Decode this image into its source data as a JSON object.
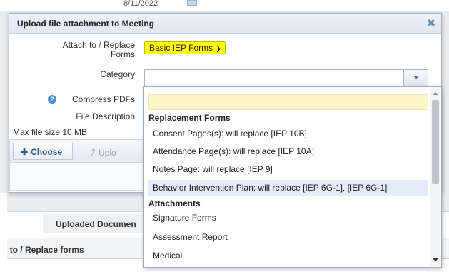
{
  "background": {
    "date": "8/11/2022",
    "uploaded_documents_header": "Uploaded Documen",
    "column_header": "h to / Replace forms"
  },
  "dialog": {
    "title": "Upload file attachment to Meeting",
    "close_icon": "close-icon",
    "close_glyph": "✖",
    "fields": {
      "attach_label": "Attach to / Replace Forms",
      "attach_value": "Basic IEP Forms",
      "category_label": "Category",
      "category_value": "",
      "compress_label": "Compress PDFs",
      "description_label": "File Description"
    },
    "max_file_size": "Max file size 10 MB",
    "toolbar": {
      "choose_label": "Choose",
      "upload_label": "Uplo"
    }
  },
  "dropdown": {
    "groups": [
      {
        "label": "Replacement Forms",
        "items": [
          "Consent Pages(s): will replace [IEP 10B]",
          "Attendance Page(s): will replace [IEP 10A]",
          "Notes Page: will replace [IEP 9]",
          "Behavior Intervention Plan: will replace [IEP 6G-1], [IEP 6G-1]"
        ]
      },
      {
        "label": "Attachments",
        "items": [
          "Signature Forms",
          "Assessment Report",
          "Medical"
        ]
      }
    ],
    "highlighted_item": "Behavior Intervention Plan: will replace [IEP 6G-1], [IEP 6G-1]"
  },
  "colors": {
    "highlight_yellow": "#ffff00",
    "blank_option_bg": "#fff6c7",
    "hover_row_bg": "#e4edf7",
    "accent_blue": "#2d5b8a"
  }
}
